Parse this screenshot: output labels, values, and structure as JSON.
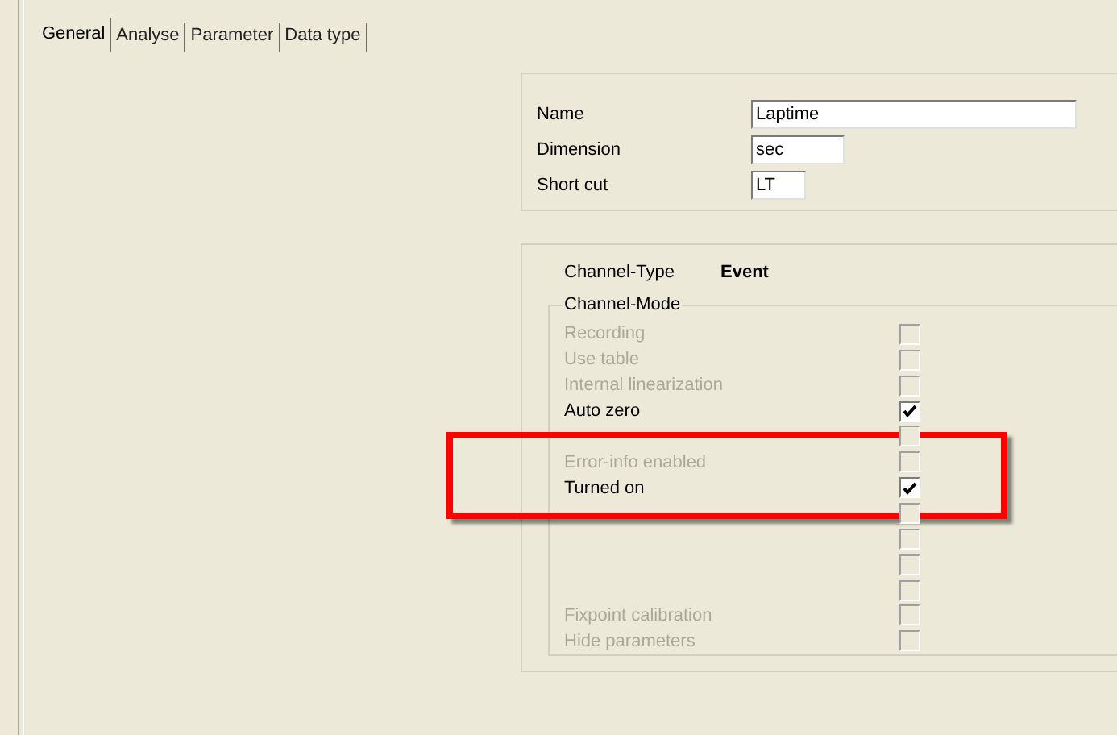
{
  "tabs": [
    {
      "label": "General",
      "selected": true
    },
    {
      "label": "Analyse",
      "selected": false
    },
    {
      "label": "Parameter",
      "selected": false
    },
    {
      "label": "Data type",
      "selected": false
    }
  ],
  "fields": [
    {
      "label": "Name",
      "value": "Laptime",
      "kind": "wide"
    },
    {
      "label": "Dimension",
      "value": "sec",
      "kind": "medium"
    },
    {
      "label": "Short cut",
      "value": "LT",
      "kind": "short"
    }
  ],
  "channel_type": {
    "label": "Channel-Type",
    "value": "Event"
  },
  "channel_mode": {
    "title": "Channel-Mode",
    "options": [
      {
        "label": "Recording",
        "checked": false,
        "disabled": true
      },
      {
        "label": "Use table",
        "checked": false,
        "disabled": true
      },
      {
        "label": "Internal linearization",
        "checked": false,
        "disabled": true
      },
      {
        "label": "Auto zero",
        "checked": true,
        "disabled": false
      },
      {
        "checked": false,
        "disabled": true
      },
      {
        "label": "Error-info enabled",
        "checked": false,
        "disabled": true
      },
      {
        "label": "Turned on",
        "checked": true,
        "disabled": false
      },
      {
        "checked": false,
        "disabled": true
      },
      {
        "checked": false,
        "disabled": true
      },
      {
        "checked": false,
        "disabled": true
      },
      {
        "checked": false,
        "disabled": true
      },
      {
        "label": "Fixpoint calibration",
        "checked": false,
        "disabled": true
      },
      {
        "label": "Hide parameters",
        "checked": false,
        "disabled": true
      }
    ]
  }
}
